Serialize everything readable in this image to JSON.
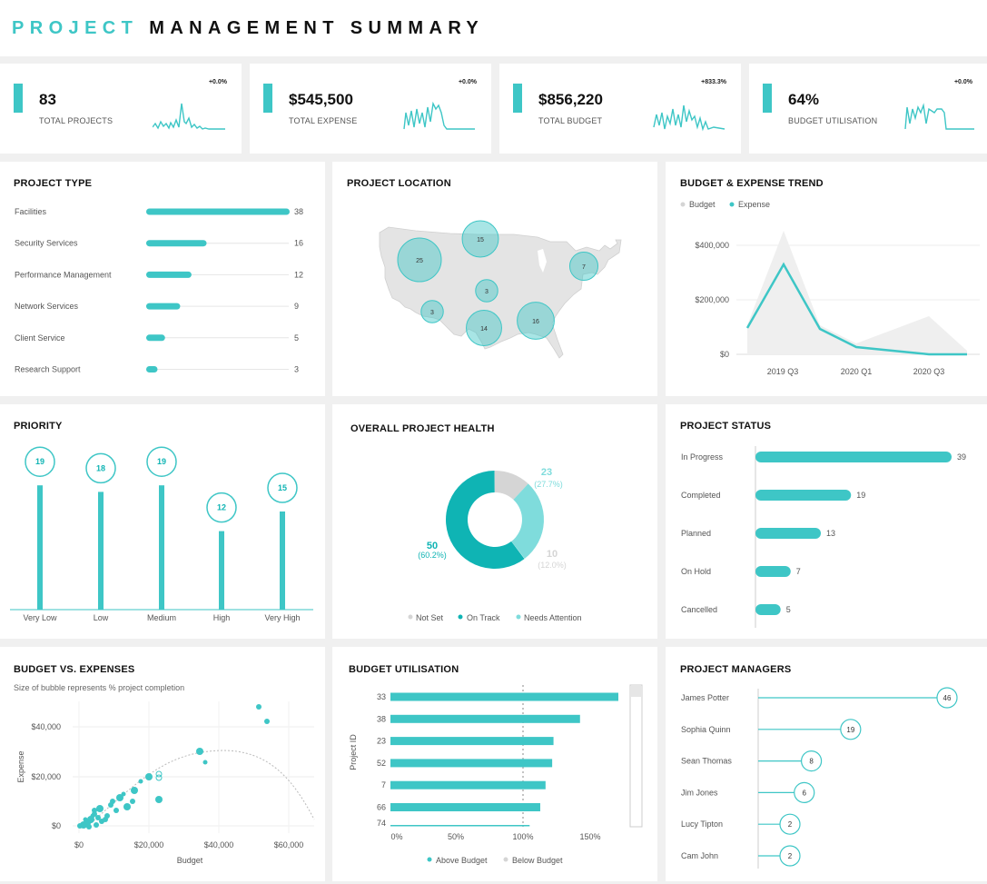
{
  "header": {
    "title_accent": "PROJECT",
    "title_main": "MANAGEMENT SUMMARY"
  },
  "colors": {
    "accent": "#3ec6c6",
    "dark_teal": "#0fb4b4",
    "light_teal": "#7fdcdc",
    "grey": "#d5d5d5"
  },
  "kpis": [
    {
      "value": "83",
      "label": "TOTAL PROJECTS",
      "change": "+0.0%"
    },
    {
      "value": "$545,500",
      "label": "TOTAL EXPENSE",
      "change": "+0.0%"
    },
    {
      "value": "$856,220",
      "label": "TOTAL BUDGET",
      "change": "+833.3%"
    },
    {
      "value": "64%",
      "label": "BUDGET UTILISATION",
      "change": "+0.0%"
    }
  ],
  "project_type": {
    "title": "PROJECT TYPE",
    "items": [
      {
        "label": "Facilities",
        "value": 38
      },
      {
        "label": "Security Services",
        "value": 16
      },
      {
        "label": "Performance Management",
        "value": 12
      },
      {
        "label": "Network Services",
        "value": 9
      },
      {
        "label": "Client Service",
        "value": 5
      },
      {
        "label": "Research Support",
        "value": 3
      }
    ]
  },
  "project_location": {
    "title": "PROJECT LOCATION",
    "bubbles": [
      25,
      15,
      7,
      3,
      3,
      14,
      16
    ]
  },
  "trend": {
    "title": "BUDGET & EXPENSE TREND",
    "legend_budget": "Budget",
    "legend_expense": "Expense",
    "y_ticks": [
      "$400,000",
      "$200,000",
      "$0"
    ],
    "x_ticks": [
      "2019 Q3",
      "2020 Q1",
      "2020 Q3"
    ]
  },
  "priority": {
    "title": "PRIORITY",
    "items": [
      {
        "label": "Very Low",
        "value": 19
      },
      {
        "label": "Low",
        "value": 18
      },
      {
        "label": "Medium",
        "value": 19
      },
      {
        "label": "High",
        "value": 12
      },
      {
        "label": "Very High",
        "value": 15
      }
    ]
  },
  "health": {
    "title": "OVERALL PROJECT HEALTH",
    "segments": [
      {
        "name": "On Track",
        "value": "50",
        "pct": "(60.2%)",
        "fraction": 0.602
      },
      {
        "name": "Not Set",
        "value": "10",
        "pct": "(12.0%)",
        "fraction": 0.12
      },
      {
        "name": "Needs Attention",
        "value": "23",
        "pct": "(27.7%)",
        "fraction": 0.277
      }
    ],
    "legend": [
      "Not Set",
      "On Track",
      "Needs Attention"
    ]
  },
  "status": {
    "title": "PROJECT STATUS",
    "items": [
      {
        "label": "In Progress",
        "value": 39
      },
      {
        "label": "Completed",
        "value": 19
      },
      {
        "label": "Planned",
        "value": 13
      },
      {
        "label": "On Hold",
        "value": 7
      },
      {
        "label": "Cancelled",
        "value": 5
      }
    ]
  },
  "budget_vs_expenses": {
    "title": "BUDGET VS. EXPENSES",
    "subtitle": "Size of bubble represents % project completion",
    "xlabel": "Budget",
    "ylabel": "Expense",
    "x_ticks": [
      "$0",
      "$20,000",
      "$40,000",
      "$60,000"
    ],
    "y_ticks": [
      "$40,000",
      "$20,000",
      "$0"
    ]
  },
  "utilisation": {
    "title": "BUDGET UTILISATION",
    "ylabel": "Project ID",
    "items": [
      {
        "id": "33",
        "value": 172
      },
      {
        "id": "38",
        "value": 143
      },
      {
        "id": "23",
        "value": 123
      },
      {
        "id": "52",
        "value": 122
      },
      {
        "id": "7",
        "value": 117
      },
      {
        "id": "66",
        "value": 113
      },
      {
        "id": "74",
        "value": 105
      }
    ],
    "x_ticks": [
      "0%",
      "50%",
      "100%",
      "150%"
    ],
    "legend_above": "Above Budget",
    "legend_below": "Below Budget"
  },
  "managers": {
    "title": "PROJECT MANAGERS",
    "items": [
      {
        "name": "James Potter",
        "value": 46
      },
      {
        "name": "Sophia Quinn",
        "value": 19
      },
      {
        "name": "Sean Thomas",
        "value": 8
      },
      {
        "name": "Jim Jones",
        "value": 6
      },
      {
        "name": "Lucy Tipton",
        "value": 2
      },
      {
        "name": "Cam John",
        "value": 2
      }
    ]
  }
}
